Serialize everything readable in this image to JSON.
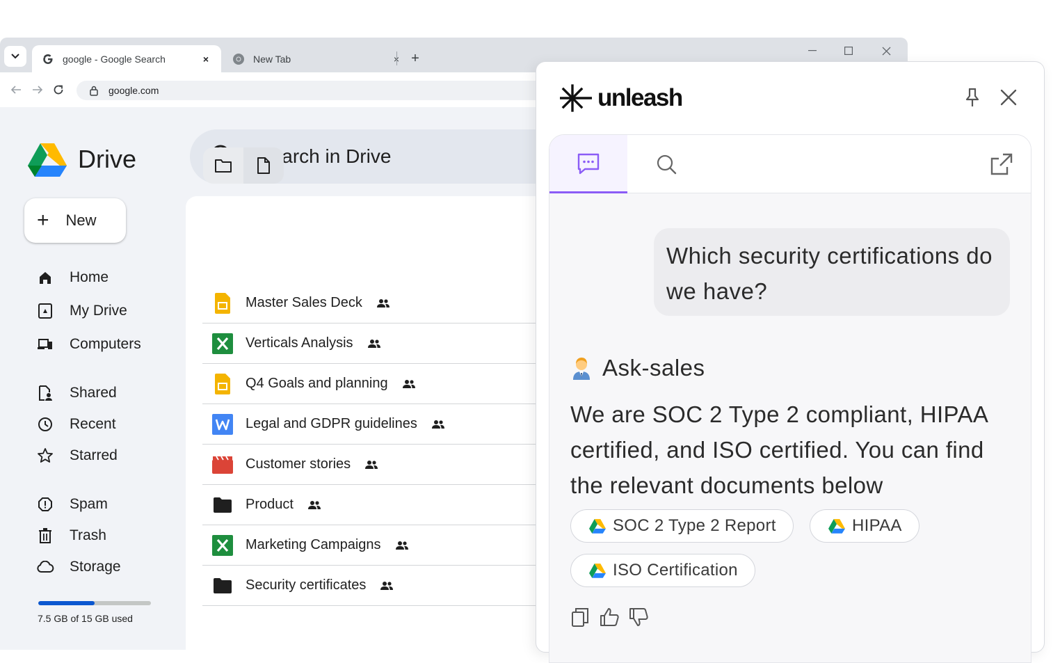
{
  "browser": {
    "active_tab_title": "google - Google Search",
    "inactive_tab_title": "New Tab",
    "url": "google.com",
    "tab_search_icon": "chevron-down-icon",
    "close_glyph": "×",
    "new_tab_glyph": "+"
  },
  "drive": {
    "app_name": "Drive",
    "search_placeholder": "Search in Drive",
    "new_button_label": "New",
    "new_button_glyph": "+",
    "sidebar": {
      "home": "Home",
      "my_drive": "My Drive",
      "computers": "Computers",
      "shared": "Shared",
      "recent": "Recent",
      "starred": "Starred",
      "spam": "Spam",
      "trash": "Trash",
      "storage": "Storage"
    },
    "storage": {
      "used_text": "7.5 GB of 15 GB used",
      "fraction": 0.5
    },
    "files": [
      {
        "name": "Master Sales Deck",
        "type": "slides"
      },
      {
        "name": "Verticals Analysis",
        "type": "sheets"
      },
      {
        "name": "Q4 Goals and planning",
        "type": "slides"
      },
      {
        "name": "Legal and GDPR guidelines",
        "type": "docs"
      },
      {
        "name": "Customer stories",
        "type": "video"
      },
      {
        "name": "Product",
        "type": "folder"
      },
      {
        "name": "Marketing Campaigns",
        "type": "sheets"
      },
      {
        "name": "Security certificates",
        "type": "folder"
      }
    ],
    "colors": {
      "accent": "#0b57d0",
      "sheets": "#1e8e3e",
      "slides": "#f4b400",
      "docs": "#4285f4",
      "video": "#db4437"
    }
  },
  "unleash": {
    "brand": "unleash",
    "question": "Which security certifications do we have?",
    "agent_name": "Ask-sales",
    "answer": "We are SOC 2 Type 2 compliant, HIPAA certified, and ISO certified. You can find the relevant documents below",
    "sources": [
      "SOC 2 Type 2 Report",
      "HIPAA",
      "ISO Certification"
    ],
    "accent_color": "#8b5cf6"
  }
}
